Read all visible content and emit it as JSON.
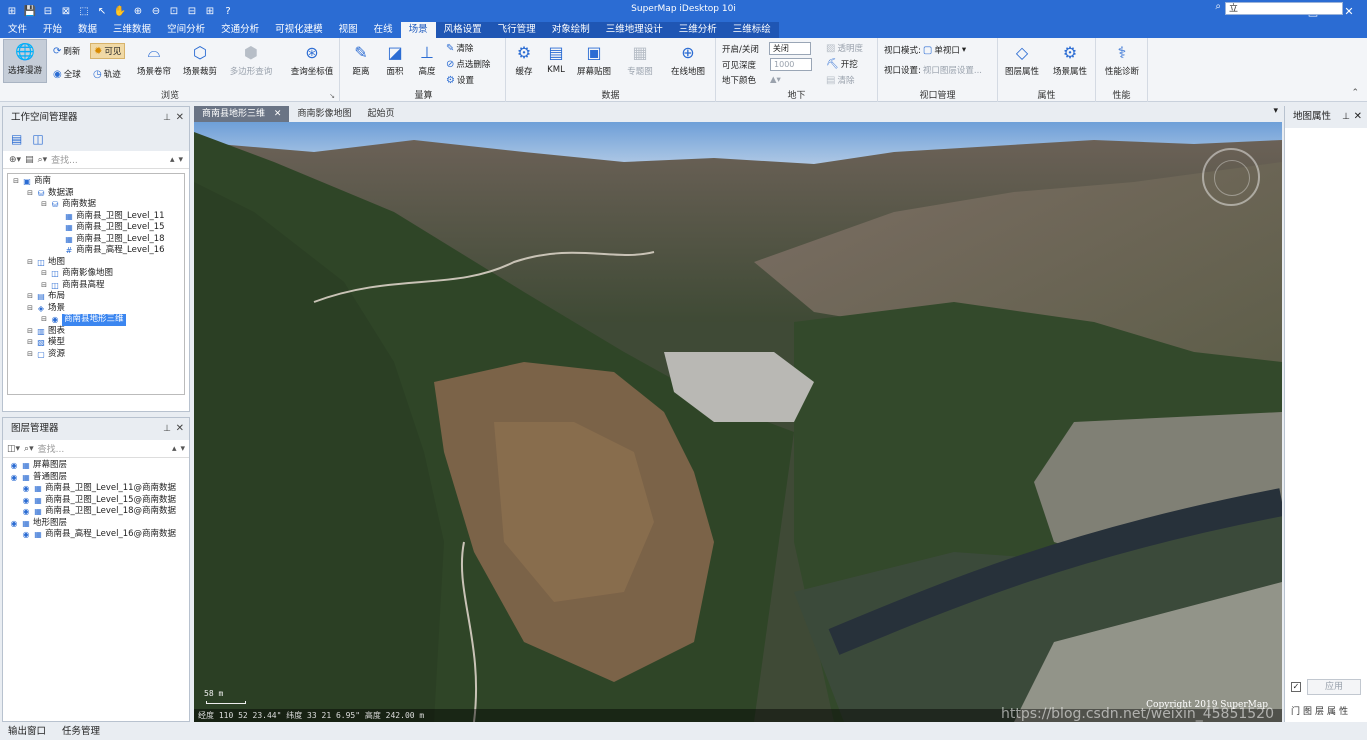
{
  "app": {
    "title": "SuperMap iDesktop 10i",
    "quick_access": [
      "⊞",
      "💾",
      "⊟",
      "⊠",
      "⬚",
      "↖",
      "✋",
      "⊕",
      "⊖",
      "⊡",
      "⊟",
      "⊞",
      "?"
    ],
    "window_controls": [
      "⧉",
      "—",
      "□",
      "✕"
    ]
  },
  "menu": {
    "items": [
      "文件",
      "开始",
      "数据",
      "三维数据",
      "空间分析",
      "交通分析",
      "可视化建模",
      "视图",
      "在线",
      "场景",
      "风格设置",
      "飞行管理",
      "对象绘制",
      "三维地理设计",
      "三维分析",
      "三维标绘"
    ],
    "active": "场景",
    "search_value": "立"
  },
  "ribbon": {
    "browse": {
      "label": "浏览",
      "select_roam": "选择漫游",
      "refresh": "刷新",
      "visible": "可见",
      "full": "全球",
      "track": "轨迹",
      "scene_curtain": "场景卷帘",
      "scene_cut": "场景裁剪",
      "poly_query": "多边形查询"
    },
    "coords": {
      "label": "查询坐标值"
    },
    "measure": {
      "label": "量算",
      "distance": "距离",
      "area": "面积",
      "height": "高度",
      "clear": "清除",
      "point_delete": "点选删除",
      "settings": "设置"
    },
    "data": {
      "label": "数据",
      "cache": "缓存",
      "kml": "KML",
      "screen_tile": "屏幕贴图",
      "topic_map": "专题图",
      "online_map": "在线地图"
    },
    "underground": {
      "label": "地下",
      "toggle_label": "开启/关闭",
      "toggle_value": "关闭",
      "depth_label": "可见深度",
      "depth_value": "1000",
      "color_label": "地下颜色",
      "transparency": "透明度",
      "excavate": "开挖",
      "clear": "清除"
    },
    "viewport": {
      "label": "视口管理",
      "mode_label": "视口模式:",
      "mode_value": "单视口",
      "settings_label": "视口设置:",
      "settings_value": "视口图层设置..."
    },
    "props": {
      "label": "属性",
      "layer_props": "图层属性",
      "scene_props": "场景属性"
    },
    "perf": {
      "label": "性能",
      "diagnose": "性能诊断"
    }
  },
  "workspace": {
    "title": "工作空间管理器",
    "search_placeholder": "查找...",
    "tree": [
      {
        "indent": 0,
        "icon": "▣",
        "label": "商南"
      },
      {
        "indent": 1,
        "icon": "⛁",
        "label": "数据源"
      },
      {
        "indent": 2,
        "icon": "⛁",
        "label": "商南数据"
      },
      {
        "indent": 3,
        "icon": "▦",
        "label": "商南县_卫图_Level_11"
      },
      {
        "indent": 3,
        "icon": "▦",
        "label": "商南县_卫图_Level_15"
      },
      {
        "indent": 3,
        "icon": "▦",
        "label": "商南县_卫图_Level_18"
      },
      {
        "indent": 3,
        "icon": "#",
        "label": "商南县_高程_Level_16"
      },
      {
        "indent": 1,
        "icon": "◫",
        "label": "地图"
      },
      {
        "indent": 2,
        "icon": "◫",
        "label": "商南影像地图"
      },
      {
        "indent": 2,
        "icon": "◫",
        "label": "商南县高程"
      },
      {
        "indent": 1,
        "icon": "▤",
        "label": "布局"
      },
      {
        "indent": 1,
        "icon": "◈",
        "label": "场景"
      },
      {
        "indent": 2,
        "icon": "◉",
        "label": "商南县地形三维",
        "selected": true
      },
      {
        "indent": 1,
        "icon": "▥",
        "label": "图表"
      },
      {
        "indent": 1,
        "icon": "▧",
        "label": "模型"
      },
      {
        "indent": 1,
        "icon": "▢",
        "label": "资源"
      }
    ]
  },
  "layers": {
    "title": "图层管理器",
    "search_placeholder": "查找...",
    "tree": [
      {
        "indent": 0,
        "label": "屏幕图层"
      },
      {
        "indent": 0,
        "label": "普通图层"
      },
      {
        "indent": 1,
        "label": "商南县_卫图_Level_11@商南数据"
      },
      {
        "indent": 1,
        "label": "商南县_卫图_Level_15@商南数据"
      },
      {
        "indent": 1,
        "label": "商南县_卫图_Level_18@商南数据"
      },
      {
        "indent": 0,
        "label": "地形图层"
      },
      {
        "indent": 1,
        "label": "商南县_高程_Level_16@商南数据"
      }
    ]
  },
  "doc_tabs": [
    "商南县地形三维",
    "商南影像地图",
    "起始页"
  ],
  "map": {
    "status": "经度 110 52 23.44\"  纬度 33 21 6.95\"  高度 242.00 m",
    "scale": "58 m",
    "copyright": "Copyright 2019 SuperMap",
    "watermark": "https://blog.csdn.net/weixin_45851520"
  },
  "map_props": {
    "title": "地图属性",
    "apply": "应用",
    "icons": [
      "门",
      "图",
      "层",
      "属",
      "性"
    ]
  },
  "bottom": [
    "输出窗口",
    "任务管理"
  ]
}
